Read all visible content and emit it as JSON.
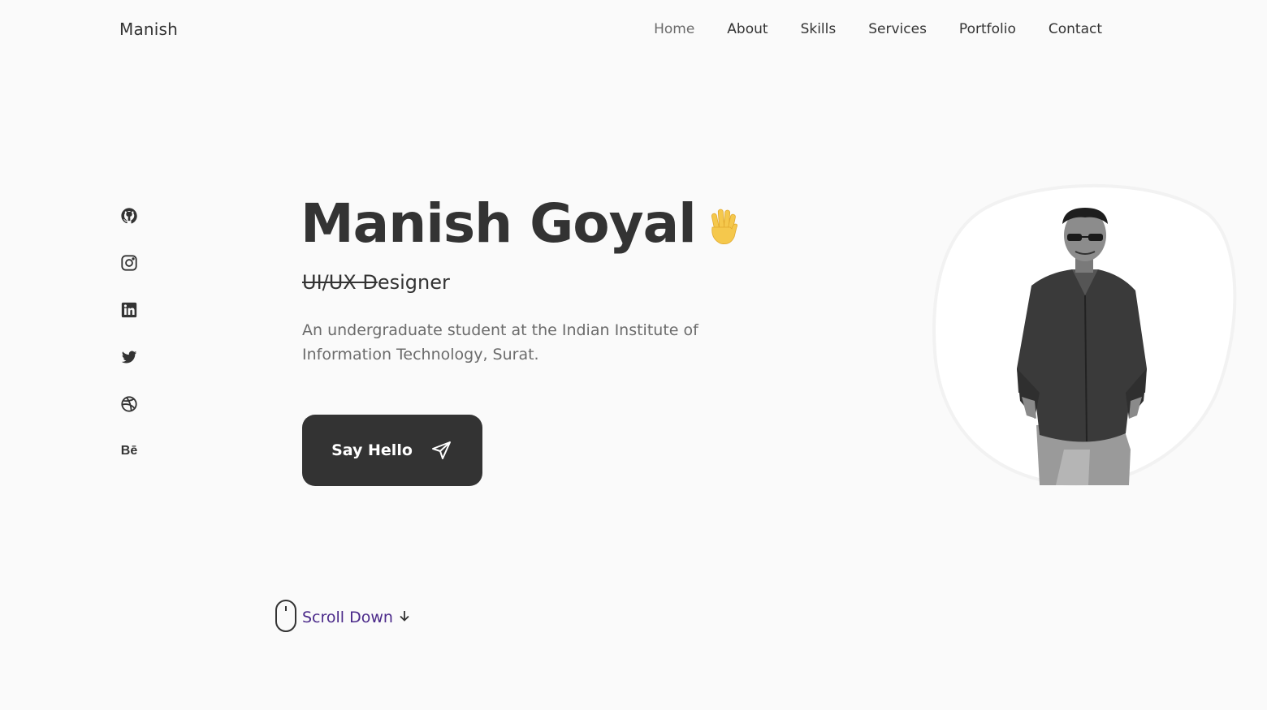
{
  "header": {
    "logo": "Manish",
    "nav": [
      "Home",
      "About",
      "Skills",
      "Services",
      "Portfolio",
      "Contact"
    ],
    "active": "Home"
  },
  "social": {
    "icons": [
      "github-icon",
      "instagram-icon",
      "linkedin-icon",
      "twitter-icon",
      "dribbble-icon",
      "behance-icon"
    ],
    "behance_label": "Bē"
  },
  "hero": {
    "name": "Manish Goyal",
    "subtitle_struck": "UI/UX D",
    "subtitle_rest": "esigner",
    "description": "An undergraduate student at the Indian Institute of Information Technology, Surat.",
    "button_label": "Say Hello"
  },
  "scroll": {
    "label": "Scroll Down"
  },
  "colors": {
    "background": "#fafafa",
    "text": "#333333",
    "muted": "#6b6b6b",
    "button": "#333333",
    "scroll_text": "#4b2a8a",
    "wave": "#f5c84c"
  }
}
